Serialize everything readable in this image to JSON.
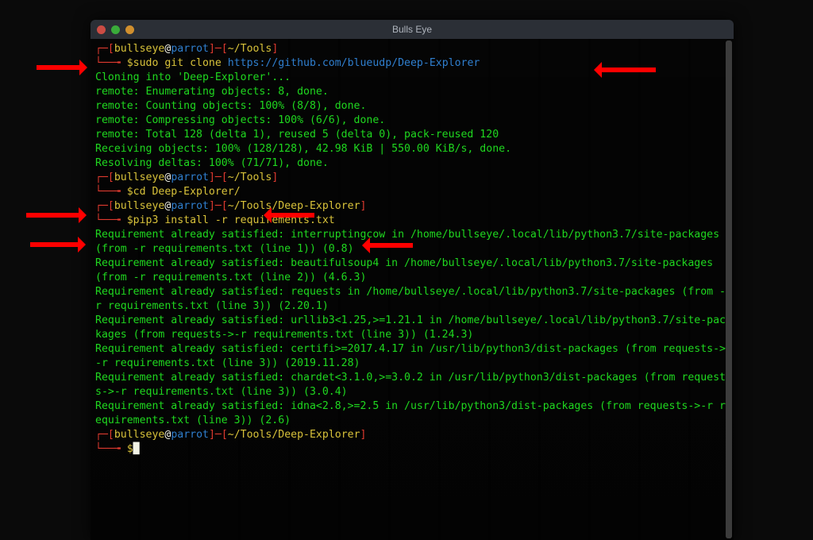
{
  "window": {
    "title": "Bulls Eye"
  },
  "prompt": {
    "user": "bullseye",
    "at": "@",
    "host": "parrot",
    "path1": "~/Tools",
    "path2": "~/Tools/Deep-Explorer",
    "dollar": "$"
  },
  "cmd": {
    "c1a": "sudo git clone ",
    "c1b": "https://github.com/blueudp/Deep-Explorer",
    "c2": "cd Deep-Explorer/",
    "c3": "pip3 install -r requirements.txt"
  },
  "out": {
    "l1": "Cloning into 'Deep-Explorer'...",
    "l2": "remote: Enumerating objects: 8, done.",
    "l3": "remote: Counting objects: 100% (8/8), done.",
    "l4": "remote: Compressing objects: 100% (6/6), done.",
    "l5": "remote: Total 128 (delta 1), reused 5 (delta 0), pack-reused 120",
    "l6": "Receiving objects: 100% (128/128), 42.98 KiB | 550.00 KiB/s, done.",
    "l7": "Resolving deltas: 100% (71/71), done.",
    "r1": "Requirement already satisfied: interruptingcow in /home/bullseye/.local/lib/python3.7/site-packages (from -r requirements.txt (line 1)) (0.8)",
    "r2": "Requirement already satisfied: beautifulsoup4 in /home/bullseye/.local/lib/python3.7/site-packages (from -r requirements.txt (line 2)) (4.6.3)",
    "r3": "Requirement already satisfied: requests in /home/bullseye/.local/lib/python3.7/site-packages (from -r requirements.txt (line 3)) (2.20.1)",
    "r4": "Requirement already satisfied: urllib3<1.25,>=1.21.1 in /home/bullseye/.local/lib/python3.7/site-packages (from requests->-r requirements.txt (line 3)) (1.24.3)",
    "r5": "Requirement already satisfied: certifi>=2017.4.17 in /usr/lib/python3/dist-packages (from requests->-r requirements.txt (line 3)) (2019.11.28)",
    "r6": "Requirement already satisfied: chardet<3.1.0,>=3.0.2 in /usr/lib/python3/dist-packages (from requests->-r requirements.txt (line 3)) (3.0.4)",
    "r7": "Requirement already satisfied: idna<2.8,>=2.5 in /usr/lib/python3/dist-packages (from requests->-r requirements.txt (line 3)) (2.6)"
  }
}
